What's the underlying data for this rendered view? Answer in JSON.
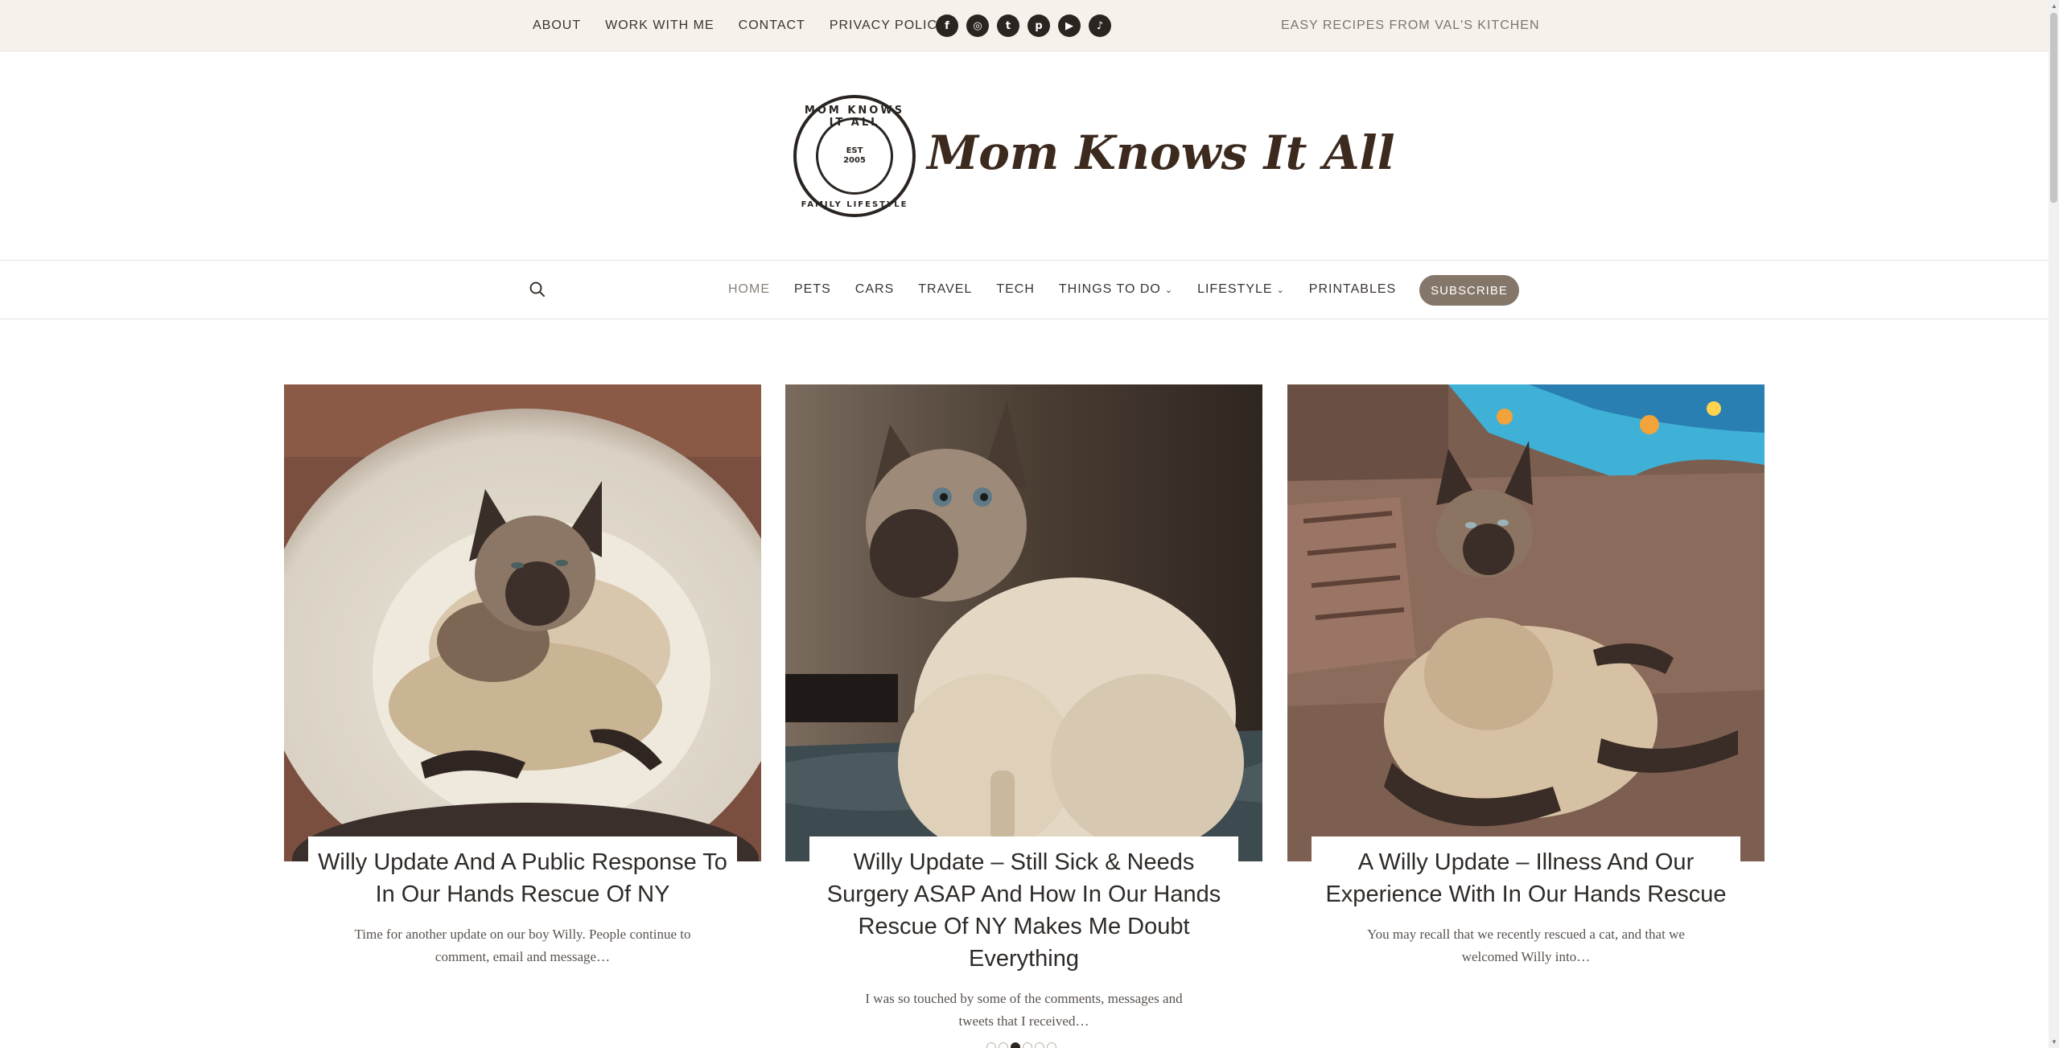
{
  "topbar": {
    "links": [
      "ABOUT",
      "WORK WITH ME",
      "CONTACT",
      "PRIVACY POLICY"
    ],
    "social_icons": [
      "facebook-icon",
      "instagram-icon",
      "twitter-icon",
      "pinterest-icon",
      "youtube-icon",
      "tiktok-icon"
    ],
    "tagline": "EASY RECIPES FROM VAL'S KITCHEN"
  },
  "header": {
    "site_title": "Mom Knows It All",
    "seal_top": "MOM KNOWS IT ALL",
    "seal_bottom": "FAMILY LIFESTYLE",
    "seal_center_1": "EST",
    "seal_center_2": "2005"
  },
  "nav": {
    "items": [
      {
        "label": "HOME",
        "active": true,
        "dropdown": false
      },
      {
        "label": "PETS",
        "active": false,
        "dropdown": false
      },
      {
        "label": "CARS",
        "active": false,
        "dropdown": false
      },
      {
        "label": "TRAVEL",
        "active": false,
        "dropdown": false
      },
      {
        "label": "TECH",
        "active": false,
        "dropdown": false
      },
      {
        "label": "THINGS TO DO",
        "active": false,
        "dropdown": true
      },
      {
        "label": "LIFESTYLE",
        "active": false,
        "dropdown": true
      },
      {
        "label": "PRINTABLES",
        "active": false,
        "dropdown": false
      }
    ],
    "subscribe_label": "SUBSCRIBE"
  },
  "posts": [
    {
      "title": "Willy Update And A Public Response To In Our Hands Rescue Of NY",
      "excerpt": "Time for another update on our boy Willy. People continue to comment, email and message…"
    },
    {
      "title": "Willy Update – Still Sick & Needs Surgery ASAP And How In Our Hands Rescue Of NY Makes Me Doubt Everything",
      "excerpt": "I was so touched by some of the comments, messages and tweets that I received…"
    },
    {
      "title": "A Willy Update – Illness And Our Experience With In Our Hands Rescue",
      "excerpt": "You may recall that we recently rescued a cat, and that we welcomed Willy into…"
    }
  ],
  "carousel": {
    "count": 6,
    "active_index": 2
  },
  "colors": {
    "topbar_bg": "#f6f1ea",
    "subscribe_bg": "#847669",
    "title_brown": "#3c2a1f"
  }
}
